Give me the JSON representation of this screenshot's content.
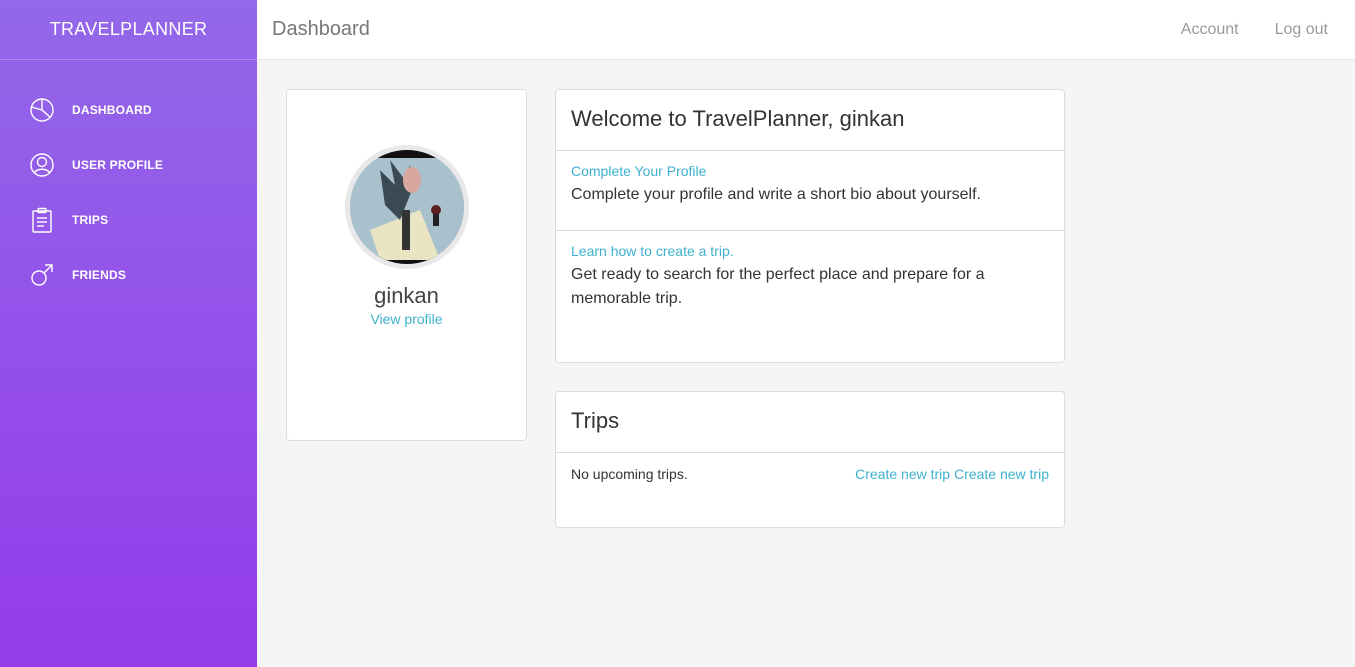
{
  "sidebar": {
    "brand": "TRAVELPLANNER",
    "items": [
      {
        "label": "DASHBOARD",
        "icon": "pie-chart-icon"
      },
      {
        "label": "USER PROFILE",
        "icon": "user-circle-icon"
      },
      {
        "label": "TRIPS",
        "icon": "clipboard-icon"
      },
      {
        "label": "FRIENDS",
        "icon": "male-symbol-icon"
      }
    ]
  },
  "header": {
    "title": "Dashboard",
    "account": "Account",
    "logout": "Log out"
  },
  "profile": {
    "username": "ginkan",
    "view_profile": "View profile"
  },
  "welcome": {
    "title": "Welcome to TravelPlanner, ginkan",
    "sections": [
      {
        "link": "Complete Your Profile",
        "text": "Complete your profile and write a short bio about yourself."
      },
      {
        "link": "Learn how to create a trip.",
        "text": "Get ready to search for the perfect place and prepare for a memorable trip."
      }
    ]
  },
  "trips": {
    "title": "Trips",
    "empty": "No upcoming trips.",
    "create_links": [
      "Create new trip",
      "Create new trip"
    ]
  },
  "colors": {
    "sidebar_top": "#9368e9",
    "sidebar_bottom": "#943bea",
    "link": "#3fb1cf"
  }
}
